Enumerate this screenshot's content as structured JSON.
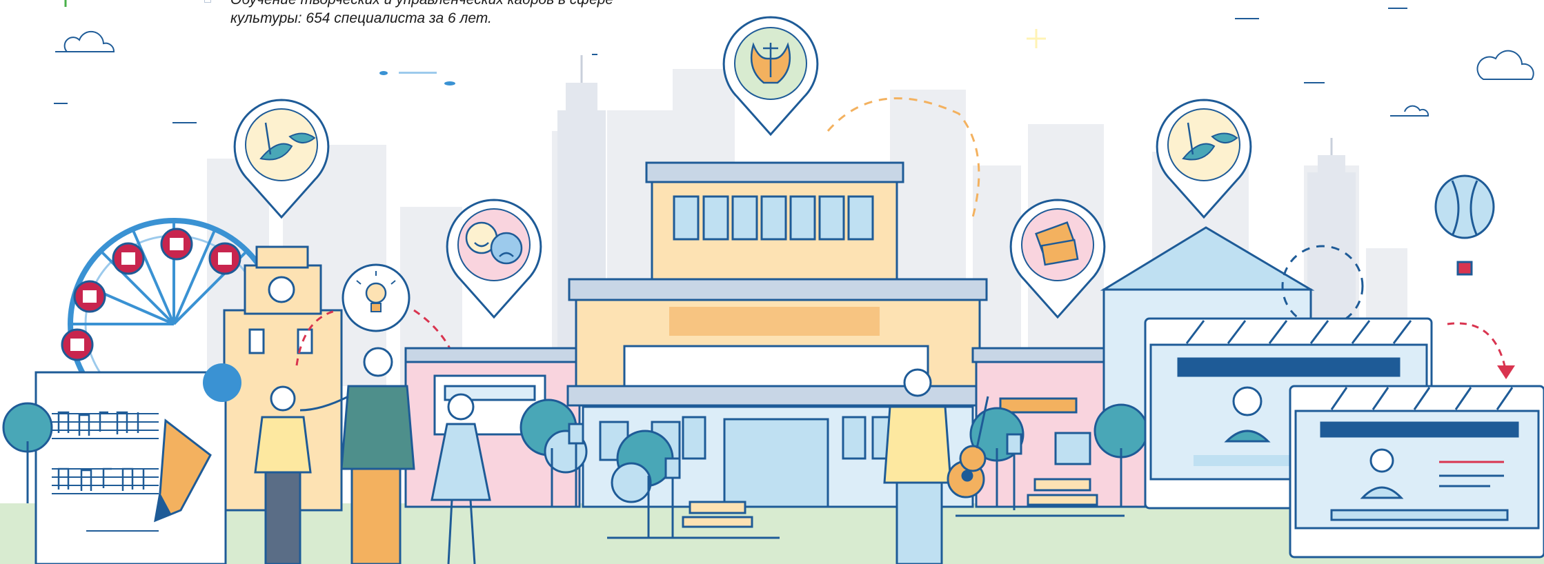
{
  "caption": {
    "line1": "Обучение творческих и управленческих кадров в сфере",
    "line2": "культуры: 654 специалиста за 6 лет."
  },
  "colors": {
    "outline": "#1e5b97",
    "sky_blue": "#bfe0f2",
    "light_blue": "#dcedf8",
    "peach": "#fde2b3",
    "orange": "#f3b15f",
    "pink": "#f9d4de",
    "teal": "#49a7b7",
    "grass": "#d8ebd0",
    "city_gray": "#eceef2",
    "red_accent": "#d9344f"
  },
  "pins": [
    {
      "icon": "carnival-mask-icon"
    },
    {
      "icon": "theater-masks-icon"
    },
    {
      "icon": "lyre-icon"
    },
    {
      "icon": "tickets-icon"
    },
    {
      "icon": "carnival-mask-icon"
    }
  ]
}
